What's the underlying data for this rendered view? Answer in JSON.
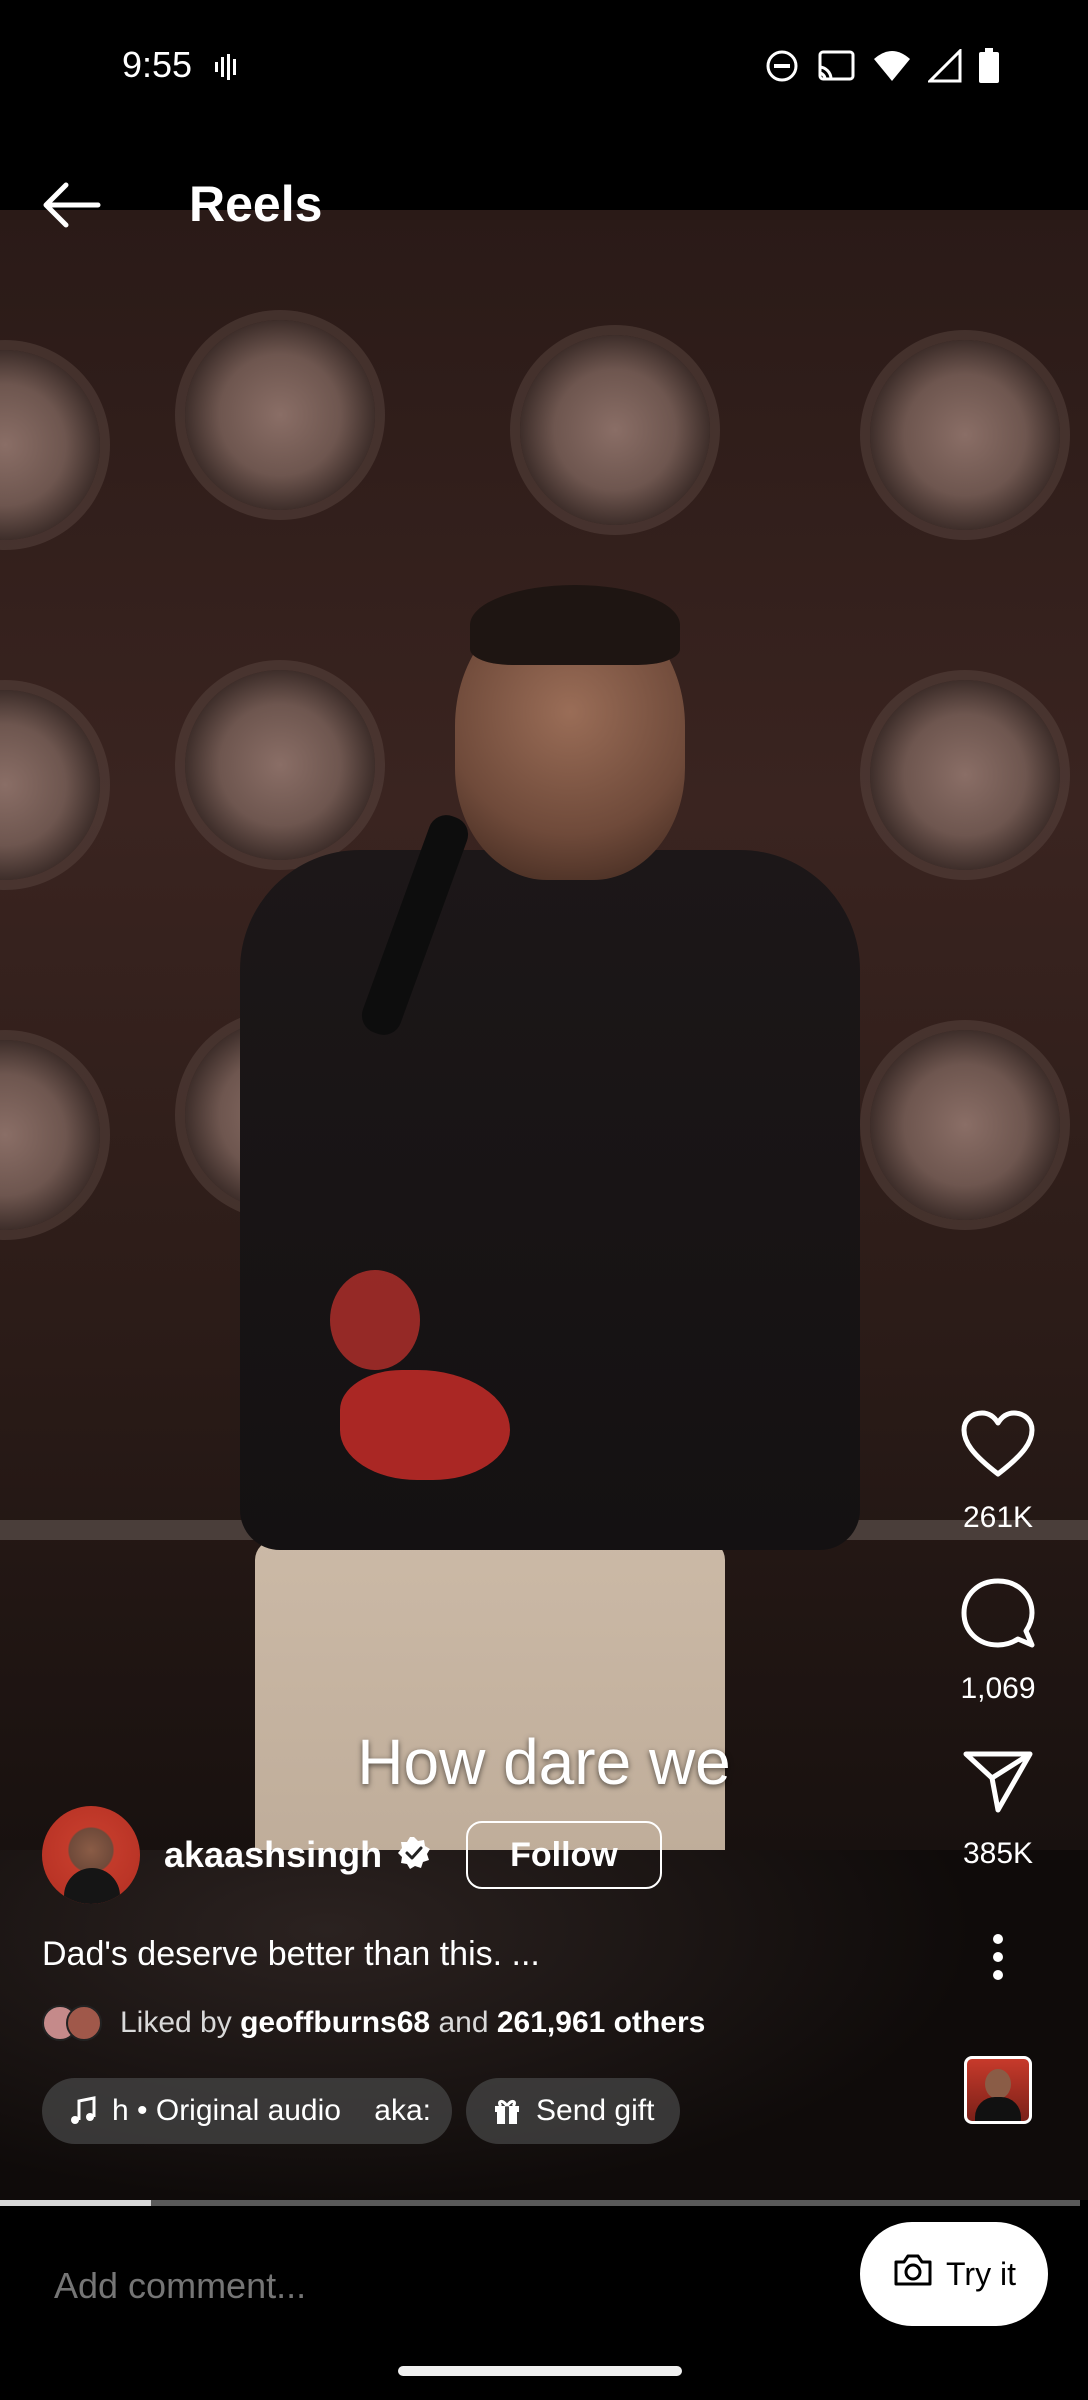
{
  "status_bar": {
    "time": "9:55"
  },
  "header": {
    "title": "Reels"
  },
  "video": {
    "caption": "How dare we",
    "progress_fraction": 0.14
  },
  "actions": {
    "likes": "261K",
    "comments": "1,069",
    "shares": "385K"
  },
  "author": {
    "username": "akaashsingh",
    "follow_label": "Follow"
  },
  "post": {
    "description": "Dad's deserve better than this. ...",
    "liked_by_prefix": "Liked by",
    "liked_by_user": "geoffburns68",
    "liked_by_and": "and",
    "liked_by_others": "261,961 others"
  },
  "audio": {
    "label": "h • Original audio    aka:"
  },
  "gift": {
    "label": "Send gift"
  },
  "comment": {
    "placeholder": "Add comment..."
  },
  "try_it": {
    "label": "Try it"
  },
  "colors": {
    "background": "#000000",
    "pill_bg": "#464646",
    "muted_text": "#a8a8a8"
  }
}
